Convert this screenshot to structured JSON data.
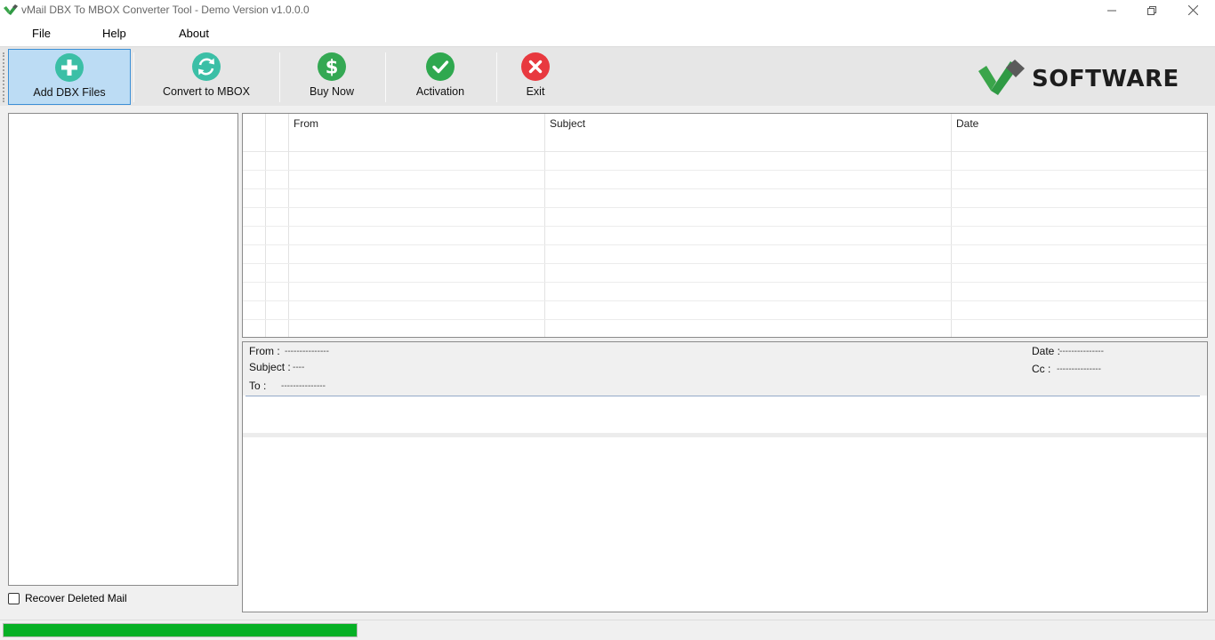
{
  "window": {
    "title": "vMail DBX To MBOX Converter Tool - Demo Version v1.0.0.0"
  },
  "menu": {
    "items": [
      {
        "label": "File"
      },
      {
        "label": "Help"
      },
      {
        "label": "About"
      }
    ]
  },
  "toolbar": {
    "buttons": [
      {
        "label": "Add DBX Files",
        "icon": "plus-circle-icon",
        "color": "#3bbfa6"
      },
      {
        "label": "Convert to MBOX",
        "icon": "sync-icon",
        "color": "#3bbfa6"
      },
      {
        "label": "Buy Now",
        "icon": "dollar-icon",
        "color": "#34a853"
      },
      {
        "label": "Activation",
        "icon": "check-circle-icon",
        "color": "#2fa84f"
      },
      {
        "label": "Exit",
        "icon": "close-circle-icon",
        "color": "#e8393f"
      }
    ],
    "brand": "SOFTWARE"
  },
  "left": {
    "recover_label": "Recover Deleted Mail",
    "recover_checked": false
  },
  "grid": {
    "columns": [
      "From",
      "Subject",
      "Date"
    ],
    "rows": []
  },
  "preview": {
    "from_label": "From :",
    "from_value": "---------------",
    "subject_label": "Subject :",
    "subject_value": "----",
    "to_label": "To :",
    "to_value": "---------------",
    "date_label": "Date :",
    "date_value": "---------------",
    "cc_label": "Cc :",
    "cc_value": "---------------"
  },
  "status": {
    "progress": 1.0
  },
  "colors": {
    "accent": "#3c8fd6",
    "active_bg": "#bcdcf4",
    "progress": "#06b025"
  }
}
